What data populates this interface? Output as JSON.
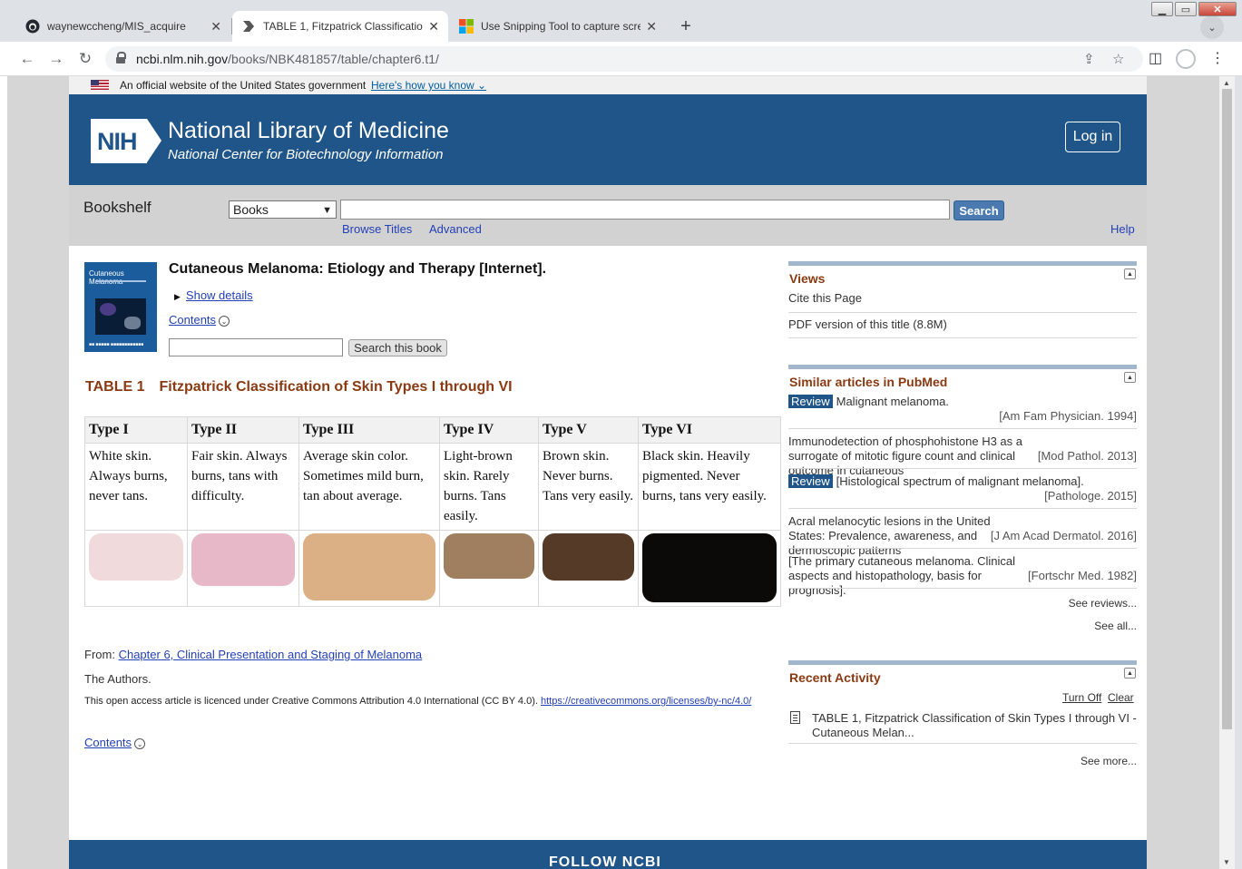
{
  "browser": {
    "tabs": [
      {
        "title": "waynewccheng/MIS_acquire",
        "icon": "github-icon"
      },
      {
        "title": "TABLE 1, Fitzpatrick Classification",
        "icon": "ncbi-icon"
      },
      {
        "title": "Use Snipping Tool to capture scre",
        "icon": "microsoft-icon"
      }
    ],
    "url_host": "ncbi.nlm.nih.gov",
    "url_path": "/books/NBK481857/table/chapter6.t1/"
  },
  "gov_banner": {
    "text": "An official website of the United States government",
    "link": "Here's how you know"
  },
  "header": {
    "logo": "NIH",
    "title": "National Library of Medicine",
    "subtitle": "National Center for Biotechnology Information",
    "login": "Log in"
  },
  "search": {
    "label": "Bookshelf",
    "db_selected": "Books",
    "button": "Search",
    "browse": "Browse Titles",
    "advanced": "Advanced",
    "help": "Help"
  },
  "book": {
    "cover_title": "Cutaneous Melanoma",
    "title": "Cutaneous Melanoma: Etiology and Therapy [Internet].",
    "show_details": "Show details",
    "contents": "Contents",
    "search_button": "Search this book"
  },
  "table": {
    "label": "TABLE 1",
    "title": "Fitzpatrick Classification of Skin Types I through VI",
    "columns": [
      {
        "type": "Type I",
        "desc": "White skin. Always burns, never tans.",
        "color": "#f1dadb"
      },
      {
        "type": "Type II",
        "desc": "Fair skin. Always burns, tans with difficulty.",
        "color": "#e7b8c8"
      },
      {
        "type": "Type III",
        "desc": "Average skin color. Sometimes mild burn, tan about average.",
        "color": "#dbb085"
      },
      {
        "type": "Type IV",
        "desc": "Light-brown skin. Rarely burns. Tans easily.",
        "color": "#a07f61"
      },
      {
        "type": "Type V",
        "desc": "Brown skin. Never burns. Tans very easily.",
        "color": "#553a27"
      },
      {
        "type": "Type VI",
        "desc": "Black skin. Heavily pigmented. Never burns, tans very easily.",
        "color": "#0c0a08"
      }
    ]
  },
  "source": {
    "from_label": "From:",
    "chapter_link": "Chapter 6, Clinical Presentation and Staging of Melanoma",
    "authors": "The Authors.",
    "license": "This open access article is licenced under Creative Commons Attribution 4.0 International (CC BY 4.0).",
    "license_url": "https://creativecommons.org/licenses/by-nc/4.0/",
    "contents": "Contents"
  },
  "sidebar": {
    "views": {
      "title": "Views",
      "items": [
        "Cite this Page",
        "PDF version of this title (8.8M)"
      ]
    },
    "similar": {
      "title": "Similar articles in PubMed",
      "review_badge": "Review",
      "articles": [
        {
          "title": "Malignant melanoma.",
          "cite": "[Am Fam Physician. 1994]"
        },
        {
          "title": "Immunodetection of phosphohistone H3 as a surrogate of mitotic figure count and clinical outcome in cutaneous",
          "cite": "[Mod Pathol. 2013]"
        },
        {
          "title": "[Histological spectrum of malignant melanoma].",
          "cite": "[Pathologe. 2015]"
        },
        {
          "title": "Acral melanocytic lesions in the United States: Prevalence, awareness, and dermoscopic patterns",
          "cite": "[J Am Acad Dermatol. 2016]"
        },
        {
          "title": "[The primary cutaneous melanoma. Clinical aspects and histopathology, basis for prognosis].",
          "cite": "[Fortschr Med. 1982]"
        }
      ],
      "see_reviews": "See reviews...",
      "see_all": "See all..."
    },
    "recent": {
      "title": "Recent Activity",
      "turn_off": "Turn Off",
      "clear": "Clear",
      "item": "TABLE 1, Fitzpatrick Classification of Skin Types I through VI - Cutaneous Melan...",
      "see_more": "See more..."
    }
  },
  "footer": {
    "text": "FOLLOW NCBI"
  }
}
